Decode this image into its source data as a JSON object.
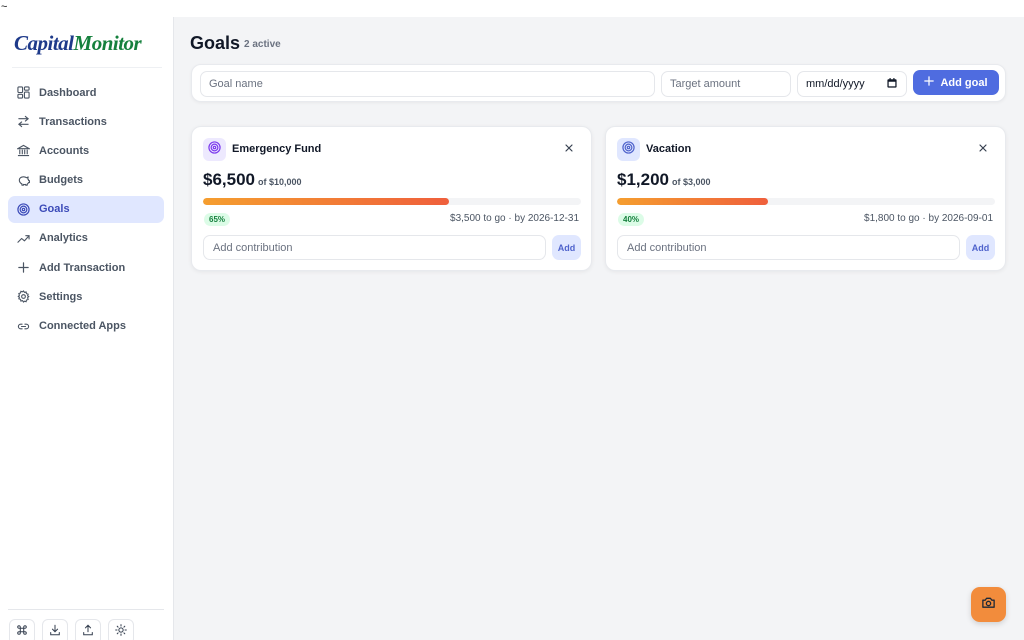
{
  "top_strip": {
    "text": "~"
  },
  "brand": {
    "part1": "Capital",
    "part2": "Monitor"
  },
  "sidebar": {
    "items": [
      {
        "label": "Dashboard",
        "icon": "dashboard-grid-icon",
        "active": false
      },
      {
        "label": "Transactions",
        "icon": "transfer-arrows-icon",
        "active": false
      },
      {
        "label": "Accounts",
        "icon": "bank-icon",
        "active": false
      },
      {
        "label": "Budgets",
        "icon": "piggy-bank-icon",
        "active": false
      },
      {
        "label": "Goals",
        "icon": "target-icon",
        "active": true
      },
      {
        "label": "Analytics",
        "icon": "trend-up-icon",
        "active": false
      },
      {
        "label": "Add Transaction",
        "icon": "plus-icon",
        "active": false
      },
      {
        "label": "Settings",
        "icon": "gear-icon",
        "active": false
      },
      {
        "label": "Connected Apps",
        "icon": "link-icon",
        "active": false
      }
    ],
    "tools": [
      "command-icon",
      "download-icon",
      "upload-icon",
      "theme-sun-icon"
    ]
  },
  "page": {
    "title": "Goals",
    "subtitle": "2 active"
  },
  "form": {
    "name_placeholder": "Goal name",
    "amount_placeholder": "Target amount",
    "date_placeholder": "mm/dd/yyyy",
    "submit_label": "Add goal"
  },
  "goals": [
    {
      "name": "Emergency Fund",
      "icon": "target-icon",
      "icon_bg": "#ede9fe",
      "icon_color": "#7c3aed",
      "current": "$6,500",
      "target_text": "of $10,000",
      "progress": 0.65,
      "percent_label": "65%",
      "meta": "$3,500 to go · by 2026-12-31",
      "contribution_placeholder": "Add contribution",
      "add_label": "Add"
    },
    {
      "name": "Vacation",
      "icon": "target-icon",
      "icon_bg": "#e0e7ff",
      "icon_color": "#4f63cc",
      "current": "$1,200",
      "target_text": "of $3,000",
      "progress": 0.4,
      "percent_label": "40%",
      "meta": "$1,800 to go · by 2026-09-01",
      "contribution_placeholder": "Add contribution",
      "add_label": "Add"
    }
  ],
  "colors": {
    "accent": "#4f6ce0",
    "active_nav_bg": "#e0e7ff",
    "progress_start": "#f59e2f",
    "progress_end": "#ef5f3c",
    "camera_button": "#f28c3c"
  },
  "floating": {
    "icon": "camera-icon"
  }
}
